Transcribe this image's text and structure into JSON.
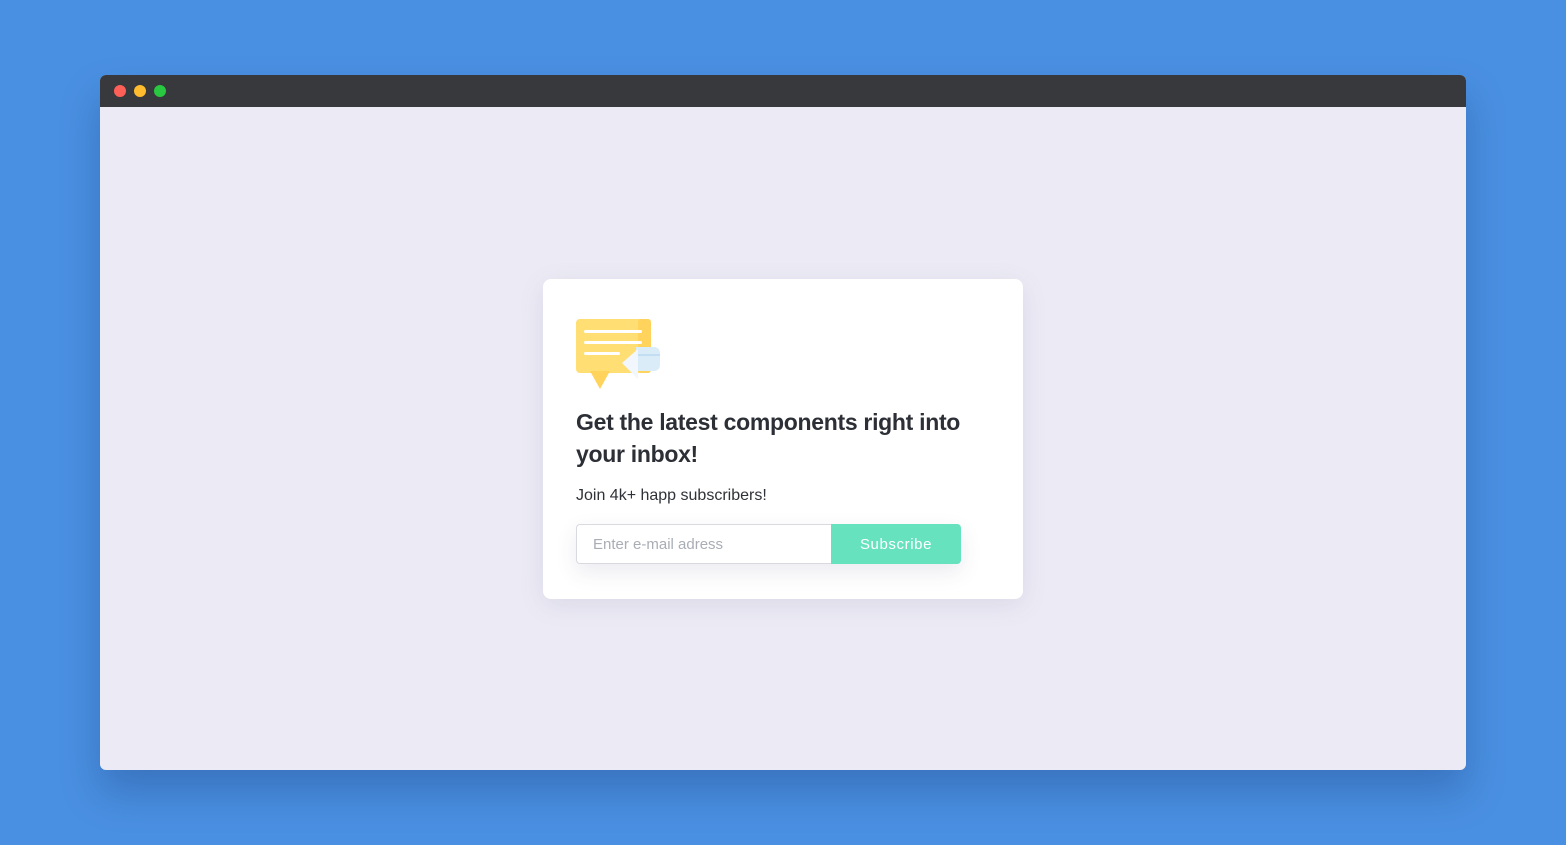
{
  "window": {
    "controls": [
      "close",
      "minimize",
      "maximize"
    ]
  },
  "card": {
    "illustration_icon": "chat-bubble-mail-icon",
    "headline": "Get the latest components right into your inbox!",
    "subtext": "Join 4k+ happ subscribers!",
    "email_placeholder": "Enter e-mail adress",
    "email_value": "",
    "subscribe_label": "Subscribe"
  },
  "colors": {
    "page_background": "#4a90e2",
    "titlebar": "#38393c",
    "window_background": "#ecebf5",
    "accent": "#67e2be",
    "close": "#fe5f57",
    "minimize": "#febc2e",
    "maximize": "#28c840"
  }
}
